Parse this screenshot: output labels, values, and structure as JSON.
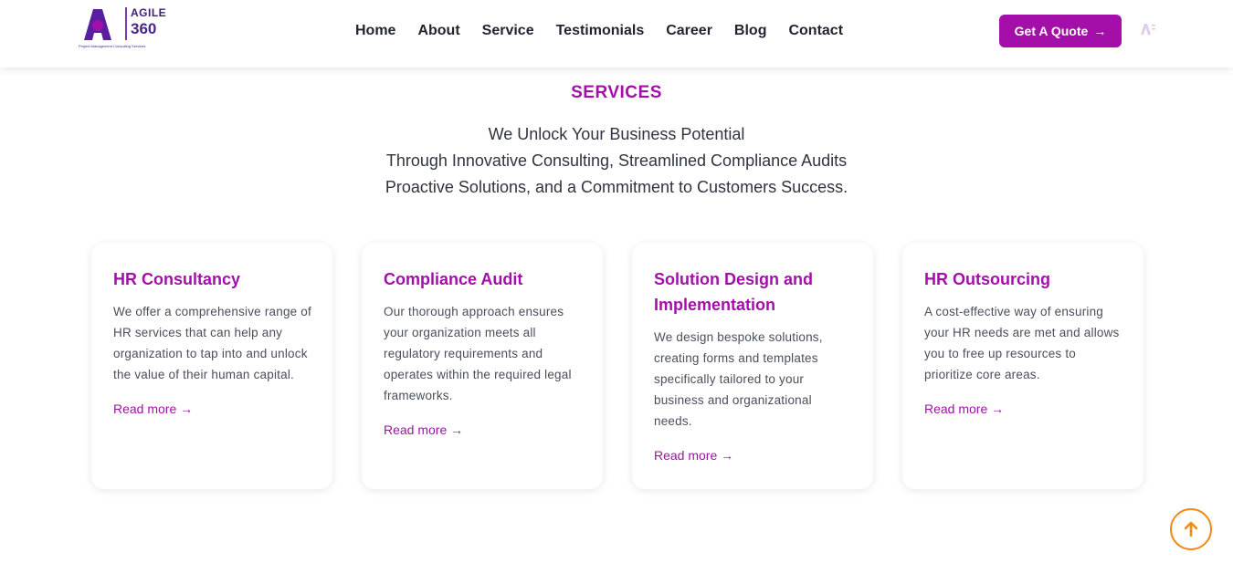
{
  "header": {
    "logo": {
      "word": "AGILE",
      "number": "360",
      "tagline": "Project Management Consulting Services"
    },
    "nav": [
      "Home",
      "About",
      "Service",
      "Testimonials",
      "Career",
      "Blog",
      "Contact"
    ],
    "quote_button": "Get A Quote",
    "quote_arrow": "→",
    "colors": {
      "brand": "#a30fa8",
      "logo_dark": "#4a2590"
    }
  },
  "section": {
    "label": "SERVICES",
    "intro_lines": [
      "We Unlock Your Business Potential",
      "Through Innovative Consulting, Streamlined Compliance Audits",
      "Proactive Solutions, and a Commitment to Customers Success."
    ]
  },
  "cards": [
    {
      "title": "HR Consultancy",
      "text": "We offer a comprehensive range of HR services that can help any organization to tap into and unlock the value of their human capital.",
      "link": "Read more →"
    },
    {
      "title": "Compliance Audit",
      "text": "Our thorough approach ensures your organization meets all regulatory requirements and operates within the required legal frameworks.",
      "link": "Read more →"
    },
    {
      "title": "Solution Design and Implementation",
      "text": "We design bespoke solutions, creating forms and templates specifically tailored to your business and organizational needs.",
      "link": "Read more →"
    },
    {
      "title": "HR Outsourcing",
      "text": "A cost-effective way of ensuring your HR needs are met and allows you to free up resources to prioritize core areas.",
      "link": "Read more →"
    }
  ],
  "scroll_top": {
    "icon": "arrow-up-icon",
    "color": "#f28a18"
  }
}
